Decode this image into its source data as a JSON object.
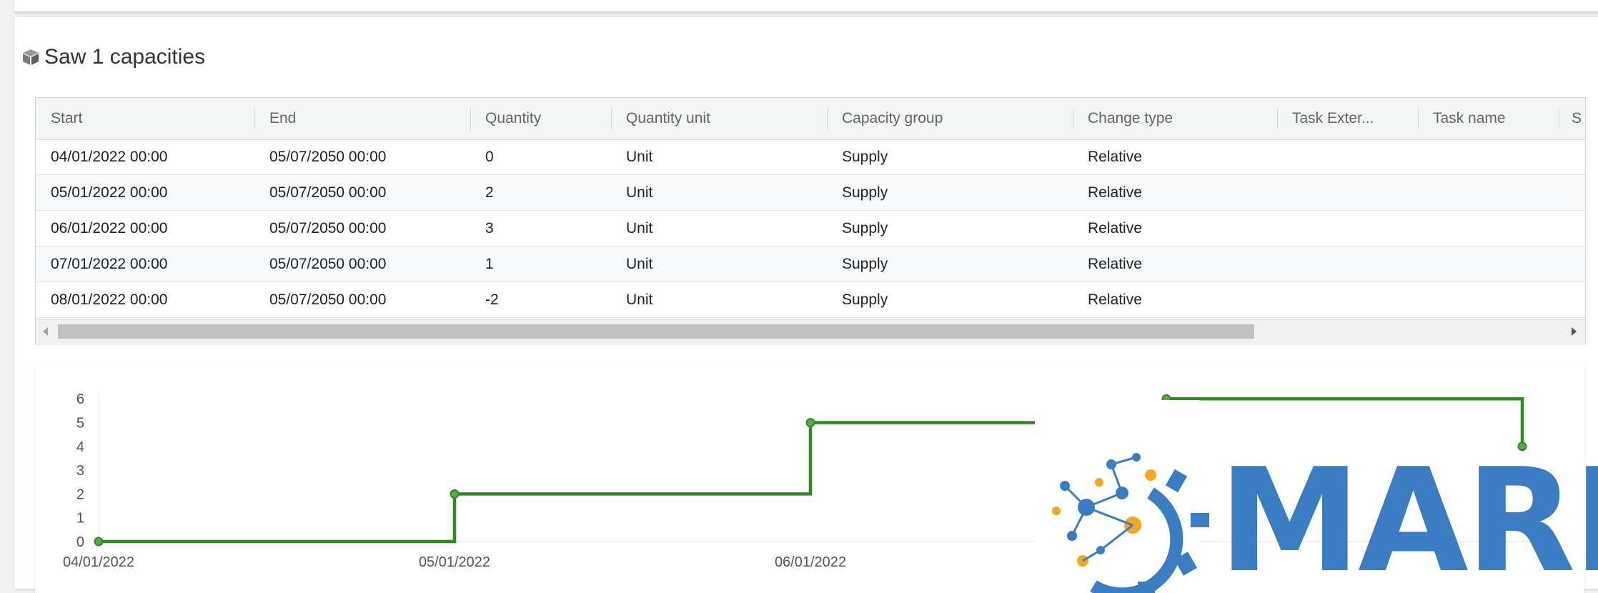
{
  "panel": {
    "title": "Saw 1 capacities",
    "title_icon": "cube-icon"
  },
  "table": {
    "columns": [
      "Start",
      "End",
      "Quantity",
      "Quantity unit",
      "Capacity group",
      "Change type",
      "Task Exter...",
      "Task name",
      "S"
    ],
    "rows": [
      [
        "04/01/2022 00:00",
        "05/07/2050 00:00",
        "0",
        "Unit",
        "Supply",
        "Relative"
      ],
      [
        "05/01/2022 00:00",
        "05/07/2050 00:00",
        "2",
        "Unit",
        "Supply",
        "Relative"
      ],
      [
        "06/01/2022 00:00",
        "05/07/2050 00:00",
        "3",
        "Unit",
        "Supply",
        "Relative"
      ],
      [
        "07/01/2022 00:00",
        "05/07/2050 00:00",
        "1",
        "Unit",
        "Supply",
        "Relative"
      ],
      [
        "08/01/2022 00:00",
        "05/07/2050 00:00",
        "-2",
        "Unit",
        "Supply",
        "Relative"
      ]
    ]
  },
  "chart_data": {
    "type": "line",
    "step": true,
    "x": [
      "04/01/2022",
      "05/01/2022",
      "06/01/2022",
      "07/01/2022",
      "08/01/2022"
    ],
    "x_tick_labels": [
      "04/01/2022",
      "05/01/2022",
      "06/01/2022"
    ],
    "series": [
      {
        "values": [
          0,
          2,
          5,
          6,
          4
        ]
      }
    ],
    "y_ticks": [
      0,
      1,
      2,
      3,
      4,
      5,
      6
    ],
    "ylim": [
      0,
      6
    ],
    "color": "#2e8b1f",
    "grid": false
  },
  "logo": {
    "text": "MARK",
    "color": "#3a7dc2",
    "accent": "#f5a623"
  }
}
